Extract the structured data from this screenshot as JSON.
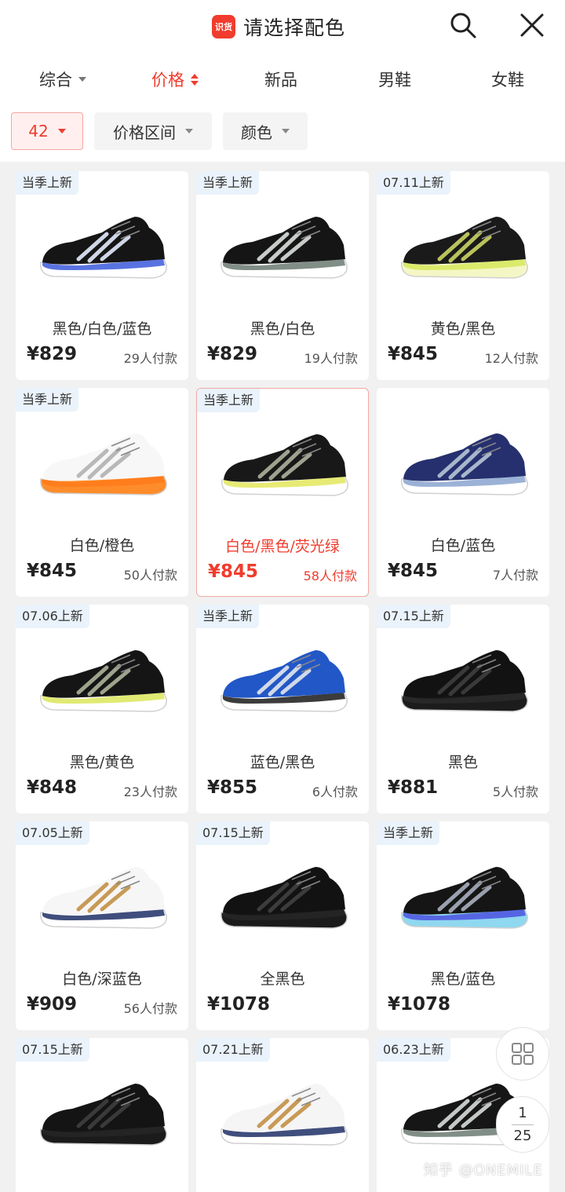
{
  "header": {
    "logo_text": "识货",
    "title": "请选择配色",
    "search_icon": "search-icon",
    "close_icon": "close-icon"
  },
  "sort_tabs": [
    {
      "label": "综合",
      "indicator": "dropdown"
    },
    {
      "label": "价格",
      "indicator": "sort-up-down",
      "active": true
    },
    {
      "label": "新品"
    },
    {
      "label": "男鞋"
    },
    {
      "label": "女鞋"
    }
  ],
  "filters": [
    {
      "label": "42",
      "selected": true
    },
    {
      "label": "价格区间"
    },
    {
      "label": "颜色"
    }
  ],
  "products": [
    {
      "tag": "当季上新",
      "color_name": "黑色/白色/蓝色",
      "price": "¥829",
      "sales": "29人付款"
    },
    {
      "tag": "当季上新",
      "color_name": "黑色/白色",
      "price": "¥829",
      "sales": "19人付款"
    },
    {
      "tag": "07.11上新",
      "color_name": "黄色/黑色",
      "price": "¥845",
      "sales": "12人付款"
    },
    {
      "tag": "当季上新",
      "color_name": "白色/橙色",
      "price": "¥845",
      "sales": "50人付款"
    },
    {
      "tag": "当季上新",
      "color_name": "白色/黑色/荧光绿",
      "price": "¥845",
      "sales": "58人付款",
      "selected": true
    },
    {
      "tag": "",
      "color_name": "白色/蓝色",
      "price": "¥845",
      "sales": "7人付款"
    },
    {
      "tag": "07.06上新",
      "color_name": "黑色/黄色",
      "price": "¥848",
      "sales": "23人付款"
    },
    {
      "tag": "当季上新",
      "color_name": "蓝色/黑色",
      "price": "¥855",
      "sales": "6人付款"
    },
    {
      "tag": "07.15上新",
      "color_name": "黑色",
      "price": "¥881",
      "sales": "5人付款"
    },
    {
      "tag": "07.05上新",
      "color_name": "白色/深蓝色",
      "price": "¥909",
      "sales": "56人付款"
    },
    {
      "tag": "07.15上新",
      "color_name": "全黑色",
      "price": "¥1078",
      "sales": ""
    },
    {
      "tag": "当季上新",
      "color_name": "黑色/蓝色",
      "price": "¥1078",
      "sales": ""
    },
    {
      "tag": "07.15上新",
      "color_name": "",
      "price": "",
      "sales": ""
    },
    {
      "tag": "07.21上新",
      "color_name": "",
      "price": "",
      "sales": ""
    },
    {
      "tag": "06.23上新",
      "color_name": "",
      "price": "",
      "sales": ""
    }
  ],
  "shoe_styles": [
    {
      "upper": "#151515",
      "accent": "#3b5bdc",
      "sole": "#ffffff",
      "stripe": "#cfd6e6"
    },
    {
      "upper": "#151515",
      "accent": "#6b7a72",
      "sole": "#ffffff",
      "stripe": "#c8ccc9"
    },
    {
      "upper": "#1a1a1a",
      "accent": "#d5e85a",
      "sole": "#f4f7c5",
      "stripe": "#b9c25c"
    },
    {
      "upper": "#f7f7f7",
      "accent": "#ff7a1a",
      "sole": "#ff8c2a",
      "stripe": "#b8b8b8"
    },
    {
      "upper": "#181818",
      "accent": "#e3e85c",
      "sole": "#ffffff",
      "stripe": "#9ea28f"
    },
    {
      "upper": "#26306e",
      "accent": "#8aa4cf",
      "sole": "#ffffff",
      "stripe": "#a9b6cc"
    },
    {
      "upper": "#151515",
      "accent": "#dbe65a",
      "sole": "#ffffff",
      "stripe": "#9da38d"
    },
    {
      "upper": "#2257c7",
      "accent": "#1a1a1a",
      "sole": "#ffffff",
      "stripe": "#d2d9e8"
    },
    {
      "upper": "#121212",
      "accent": "#2a2a2a",
      "sole": "#1c1c1c",
      "stripe": "#3a3a3a"
    },
    {
      "upper": "#f6f6f6",
      "accent": "#1f2f66",
      "sole": "#ffffff",
      "stripe": "#c79a56"
    },
    {
      "upper": "#121212",
      "accent": "#262626",
      "sole": "#1b1b1b",
      "stripe": "#3c3c3c"
    },
    {
      "upper": "#151515",
      "accent": "#4c52e0",
      "sole": "#8fd8ef",
      "stripe": "#9aa0ae"
    },
    {
      "upper": "#141414",
      "accent": "#262626",
      "sole": "#1b1b1b",
      "stripe": "#3a3a3a"
    },
    {
      "upper": "#f5f5f5",
      "accent": "#1f2f66",
      "sole": "#ffffff",
      "stripe": "#c79a56"
    },
    {
      "upper": "#161616",
      "accent": "#6b7a72",
      "sole": "#ffffff",
      "stripe": "#c5c9c6"
    }
  ],
  "floating": {
    "grid_icon": "grid-view-icon",
    "current_page": "1",
    "total_pages": "25"
  },
  "watermark": "知乎 @ONEMILE",
  "colors": {
    "accent": "#f03c2e",
    "tag_bg": "#eaf3fb",
    "page_bg": "#f1f1f1"
  }
}
